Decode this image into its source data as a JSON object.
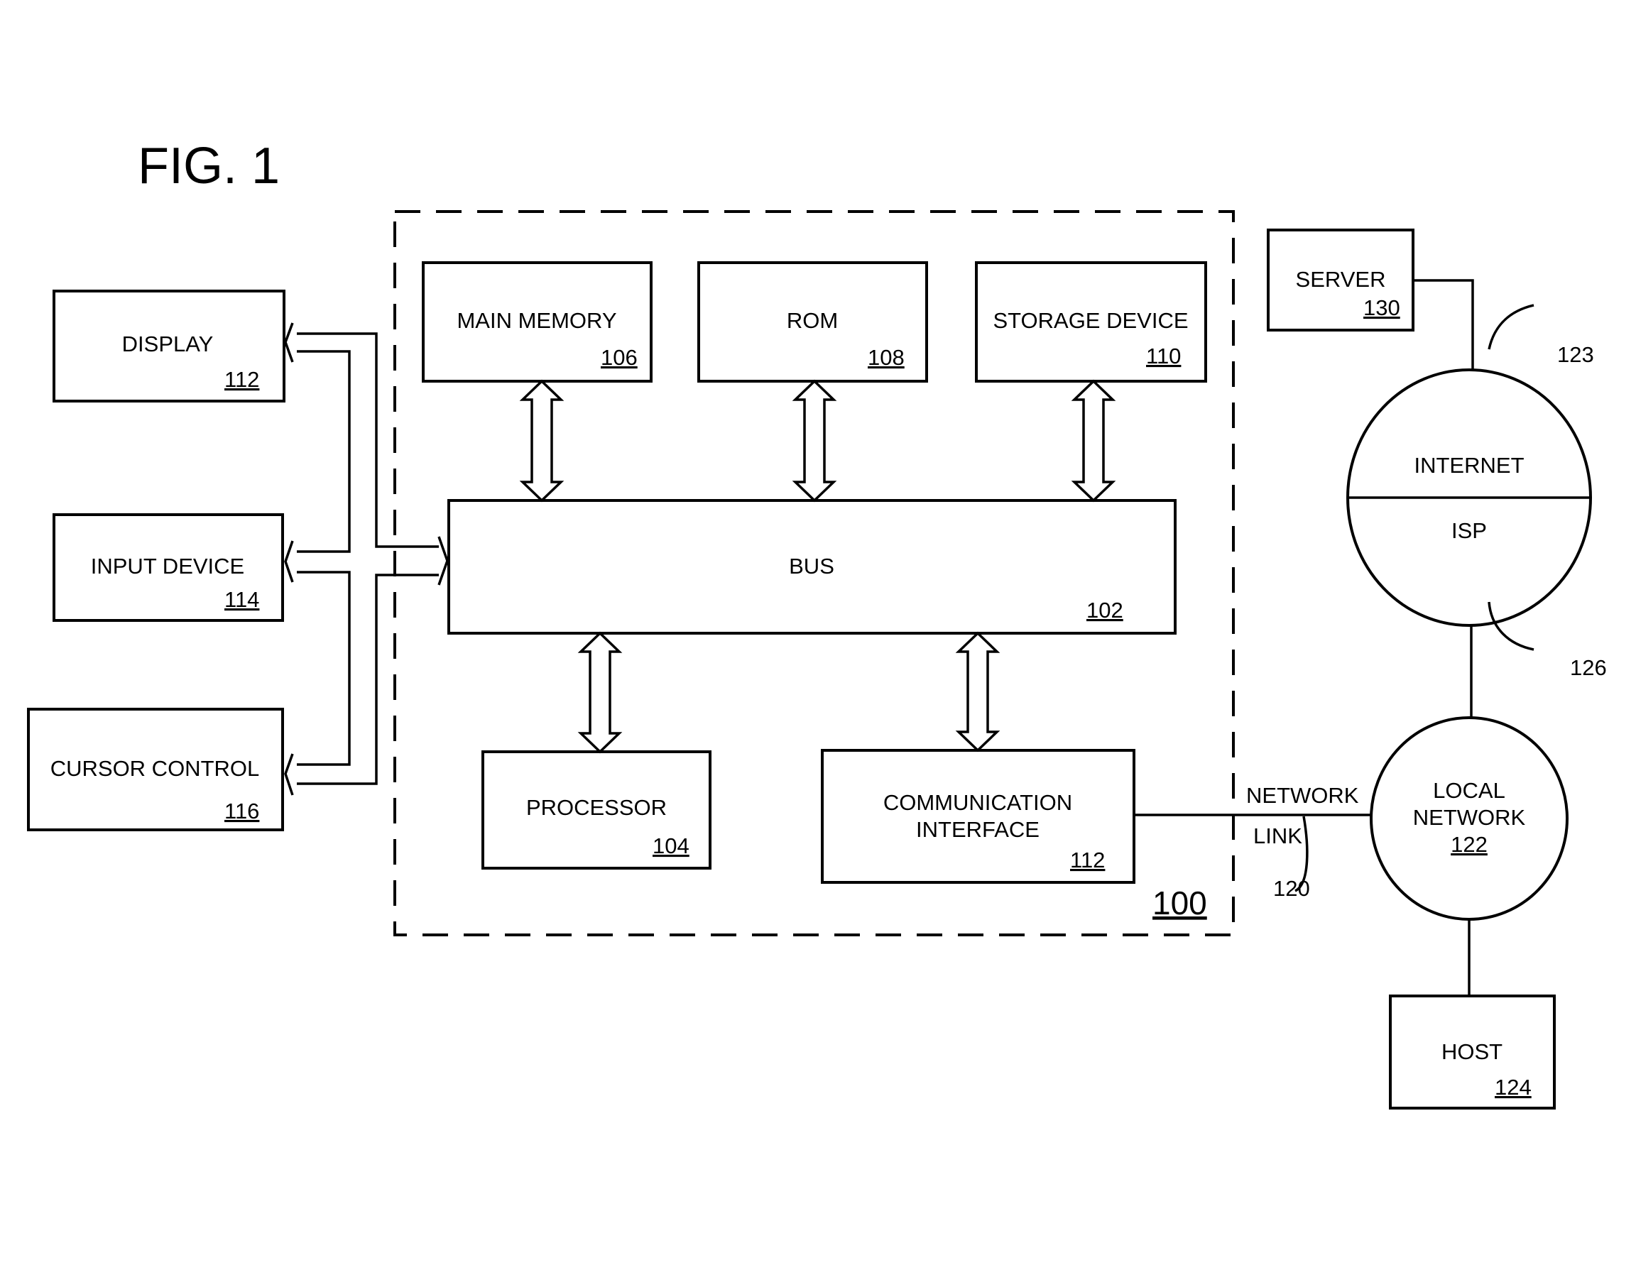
{
  "figure": {
    "title": "FIG. 1",
    "system_ref": "100"
  },
  "computer": {
    "main_memory": {
      "label": "MAIN MEMORY",
      "ref": "106"
    },
    "rom": {
      "label": "ROM",
      "ref": "108"
    },
    "storage": {
      "label": "STORAGE DEVICE",
      "ref": "110"
    },
    "bus": {
      "label": "BUS",
      "ref": "102"
    },
    "processor": {
      "label": "PROCESSOR",
      "ref": "104"
    },
    "comm": {
      "label_line1": "COMMUNICATION",
      "label_line2": "INTERFACE",
      "ref": "112"
    }
  },
  "peripherals": {
    "display": {
      "label": "DISPLAY",
      "ref": "112"
    },
    "input": {
      "label": "INPUT DEVICE",
      "ref": "114"
    },
    "cursor": {
      "label": "CURSOR CONTROL",
      "ref": "116"
    }
  },
  "network": {
    "server": {
      "label": "SERVER",
      "ref": "130"
    },
    "internet": {
      "label": "INTERNET",
      "ref": "123"
    },
    "isp": {
      "label": "ISP",
      "ref": "126"
    },
    "link": {
      "label_line1": "NETWORK",
      "label_line2": "LINK",
      "ref": "120"
    },
    "local": {
      "label_line1": "LOCAL",
      "label_line2": "NETWORK",
      "ref": "122"
    },
    "host": {
      "label": "HOST",
      "ref": "124"
    }
  }
}
